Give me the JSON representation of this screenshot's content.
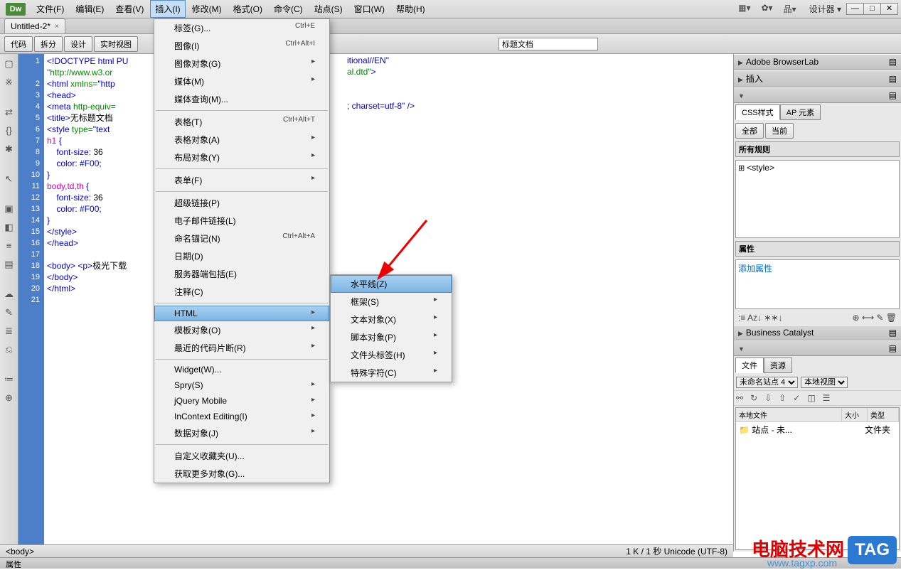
{
  "app": {
    "logo": "Dw",
    "designer": "设计器",
    "designerArrow": "▾"
  },
  "menubar": [
    "文件(F)",
    "编辑(E)",
    "查看(V)",
    "插入(I)",
    "修改(M)",
    "格式(O)",
    "命令(C)",
    "站点(S)",
    "窗口(W)",
    "帮助(H)"
  ],
  "menubarActiveIndex": 3,
  "winbtns": {
    "min": "—",
    "max": "□",
    "close": "✕"
  },
  "tab": {
    "title": "Untitled-2*",
    "close": "×"
  },
  "viewbtns": [
    "代码",
    "拆分",
    "设计",
    "实时视图"
  ],
  "titleField": {
    "value": "标题文档"
  },
  "insertMenu": {
    "groups": [
      [
        {
          "l": "标签(G)...",
          "s": "Ctrl+E"
        },
        {
          "l": "图像(I)",
          "s": "Ctrl+Alt+I"
        },
        {
          "l": "图像对象(G)",
          "sub": true
        },
        {
          "l": "媒体(M)",
          "sub": true
        },
        {
          "l": "媒体查询(M)..."
        }
      ],
      [
        {
          "l": "表格(T)",
          "s": "Ctrl+Alt+T"
        },
        {
          "l": "表格对象(A)",
          "sub": true
        },
        {
          "l": "布局对象(Y)",
          "sub": true
        }
      ],
      [
        {
          "l": "表单(F)",
          "sub": true
        }
      ],
      [
        {
          "l": "超级链接(P)"
        },
        {
          "l": "电子邮件链接(L)"
        },
        {
          "l": "命名锚记(N)",
          "s": "Ctrl+Alt+A"
        },
        {
          "l": "日期(D)"
        },
        {
          "l": "服务器端包括(E)"
        },
        {
          "l": "注释(C)"
        }
      ],
      [
        {
          "l": "HTML",
          "sub": true,
          "sel": true
        },
        {
          "l": "模板对象(O)",
          "sub": true
        },
        {
          "l": "最近的代码片断(R)",
          "sub": true
        }
      ],
      [
        {
          "l": "Widget(W)..."
        },
        {
          "l": "Spry(S)",
          "sub": true
        },
        {
          "l": "jQuery Mobile",
          "sub": true
        },
        {
          "l": "InContext Editing(I)",
          "sub": true
        },
        {
          "l": "数据对象(J)",
          "sub": true
        }
      ],
      [
        {
          "l": "自定义收藏夹(U)..."
        },
        {
          "l": "获取更多对象(G)..."
        }
      ]
    ]
  },
  "htmlSubmenu": [
    {
      "l": "水平线(Z)",
      "sel": true
    },
    {
      "l": "框架(S)",
      "sub": true
    },
    {
      "l": "文本对象(X)",
      "sub": true
    },
    {
      "l": "脚本对象(P)",
      "sub": true
    },
    {
      "l": "文件头标签(H)",
      "sub": true
    },
    {
      "l": "特殊字符(C)",
      "sub": true
    }
  ],
  "code": {
    "lines": [
      {
        "n": 1,
        "h": "<span class='c-blue'>&lt;!DOCTYPE html PU</span>"
      },
      {
        "n": 0,
        "h": "<span class='c-green'>\"http://www.w3.or</span>"
      },
      {
        "n": 2,
        "h": "<span class='c-blue'>&lt;html</span> <span class='c-green'>xmlns=</span><span class='c-blue'>\"http</span>"
      },
      {
        "n": 3,
        "h": "<span class='c-blue'>&lt;head&gt;</span>"
      },
      {
        "n": 4,
        "h": "<span class='c-blue'>&lt;meta</span> <span class='c-green'>http-equiv=</span>"
      },
      {
        "n": 5,
        "h": "<span class='c-blue'>&lt;title&gt;</span><span class='c-black'>无标题文档</span>"
      },
      {
        "n": 6,
        "h": "<span class='c-blue'>&lt;style</span> <span class='c-green'>type=</span><span class='c-blue'>\"text</span>"
      },
      {
        "n": 7,
        "h": "<span class='c-pink'>h1</span> <span class='c-blue'>{</span>"
      },
      {
        "n": 8,
        "h": "    <span class='c-blue'>font-size: </span><span class='c-black'>36</span>"
      },
      {
        "n": 9,
        "h": "    <span class='c-blue'>color: #F00;</span>"
      },
      {
        "n": 10,
        "h": "<span class='c-blue'>}</span>"
      },
      {
        "n": 11,
        "h": "<span class='c-pink'>body,td,th</span> <span class='c-blue'>{</span>"
      },
      {
        "n": 12,
        "h": "    <span class='c-blue'>font-size: </span><span class='c-black'>36</span>"
      },
      {
        "n": 13,
        "h": "    <span class='c-blue'>color: #F00;</span>"
      },
      {
        "n": 14,
        "h": "<span class='c-blue'>}</span>"
      },
      {
        "n": 15,
        "h": "<span class='c-blue'>&lt;/style&gt;</span>"
      },
      {
        "n": 16,
        "h": "<span class='c-blue'>&lt;/head&gt;</span>"
      },
      {
        "n": 17,
        "h": ""
      },
      {
        "n": 18,
        "h": "<span class='c-blue'>&lt;body&gt; &lt;p&gt;</span><span class='c-black'>极光下载</span>"
      },
      {
        "n": 19,
        "h": "<span class='c-blue'>&lt;/body&gt;</span>"
      },
      {
        "n": 20,
        "h": "<span class='c-blue'>&lt;/html&gt;</span>"
      },
      {
        "n": 21,
        "h": ""
      }
    ],
    "overflow": [
      "itional//EN\"",
      "al.dtd\"&gt;",
      "",
      "",
      "; charset=utf-8\" /&gt;"
    ]
  },
  "rightPanels": {
    "browserlab": "Adobe BrowserLab",
    "insert": "插入",
    "cssTitle": "CSS样式",
    "apTitle": "AP 元素",
    "allBtn": "全部",
    "curBtn": "当前",
    "allRules": "所有规则",
    "styleTag": "<style>",
    "props": "属性",
    "addProp": "添加属性",
    "bc": "Business Catalyst",
    "filesTab": "文件",
    "resTab": "资源",
    "site": "未命名站点 4",
    "viewMode": "本地视图",
    "cols": {
      "c1": "本地文件",
      "c2": "大小",
      "c3": "类型"
    },
    "row": {
      "name": "站点 - 未...",
      "type": "文件夹"
    }
  },
  "status": {
    "path": "<body>",
    "info": "1 K / 1 秒 Unicode (UTF-8)"
  },
  "propbar": "属性",
  "watermark": {
    "t1": "电脑技术网",
    "t2": "TAG",
    "url": "www.tagxp.com"
  }
}
